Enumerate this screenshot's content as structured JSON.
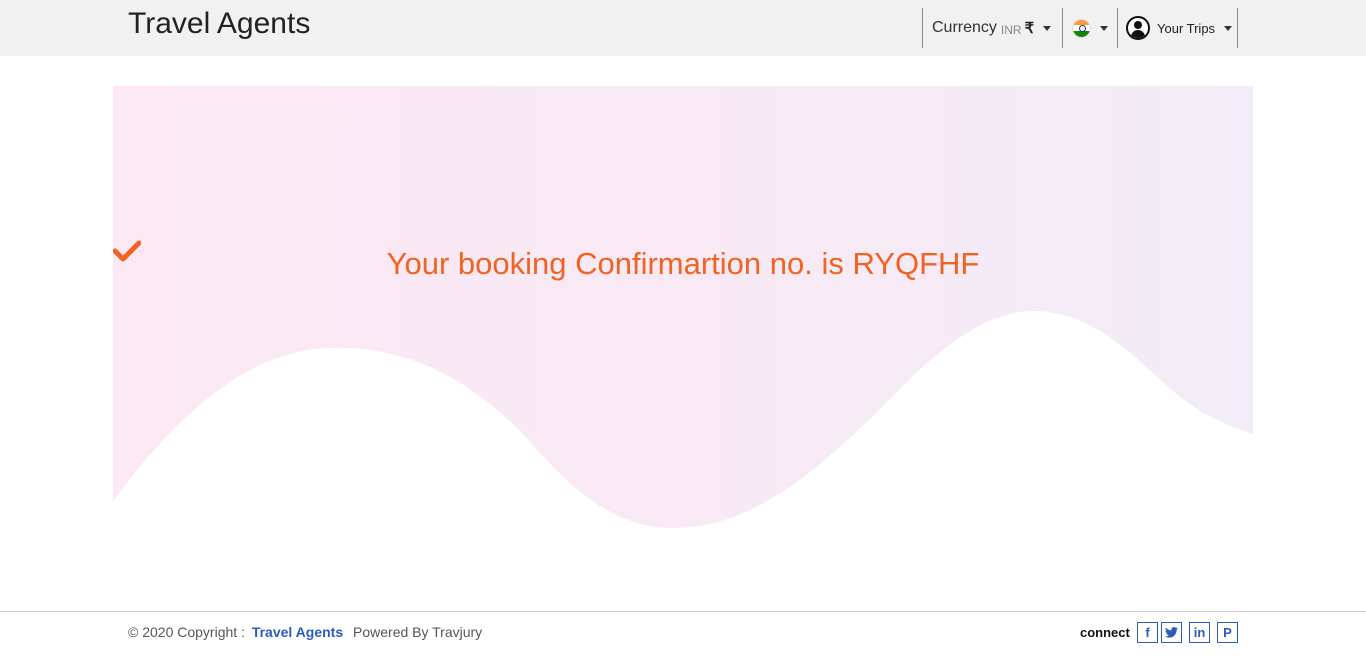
{
  "header": {
    "brand": "Travel Agents",
    "currency_label": "Currency",
    "currency_code": "INR",
    "currency_symbol": "₹",
    "country_flag_icon": "india-flag-icon",
    "trips_label": "Your Trips"
  },
  "hero": {
    "confirmation_text": "Your booking Confirmartion no. is RYQFHF",
    "confirmation_icon": "check-icon",
    "accent_color": "#f06322"
  },
  "footer": {
    "copyright_prefix": "© 2020 Copyright :",
    "company_link": "Travel Agents",
    "powered_by": "Powered By Travjury",
    "connect_label": "connect",
    "social": [
      {
        "icon": "facebook-icon",
        "glyph": "f"
      },
      {
        "icon": "twitter-icon",
        "glyph": "t"
      },
      {
        "icon": "linkedin-icon",
        "glyph": "in"
      },
      {
        "icon": "pinterest-icon",
        "glyph": "P"
      }
    ],
    "link_color": "#2b5bbb"
  }
}
